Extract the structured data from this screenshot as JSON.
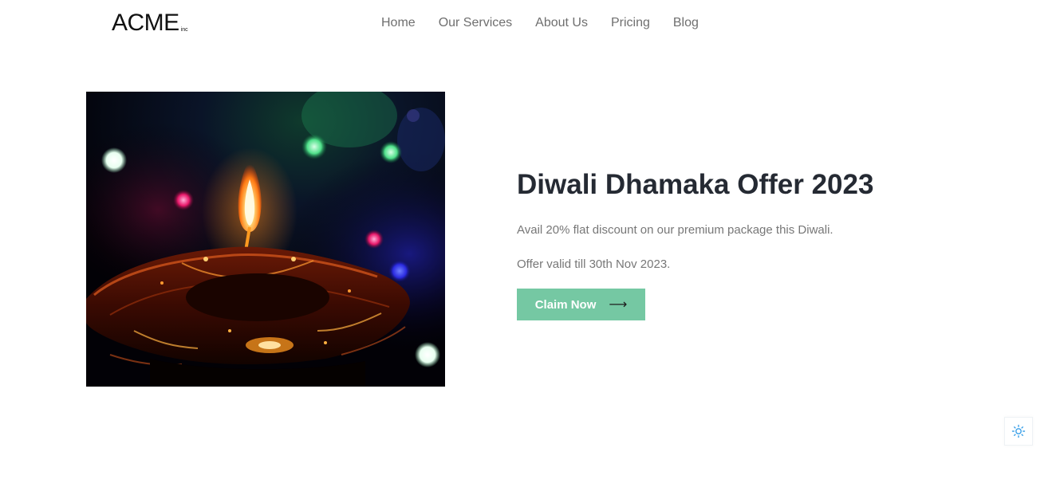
{
  "header": {
    "logo_main": "ACME",
    "logo_sub": "inc",
    "nav": [
      {
        "label": "Home"
      },
      {
        "label": "Our Services"
      },
      {
        "label": "About Us"
      },
      {
        "label": "Pricing"
      },
      {
        "label": "Blog"
      }
    ]
  },
  "hero": {
    "image_alt": "diya-image",
    "title": "Diwali Dhamaka Offer 2023",
    "line1": "Avail 20% flat discount on our premium package this Diwali.",
    "line2": "Offer valid till 30th Nov 2023.",
    "cta_label": "Claim Now",
    "cta_icon": "arrow-right-icon"
  },
  "theme_toggle": {
    "icon": "sun-icon"
  },
  "colors": {
    "accent": "#75c8a3",
    "title": "#252a33",
    "body_text": "#777777",
    "nav_text": "#6f6f6f",
    "toggle_icon": "#3aa0e8"
  }
}
